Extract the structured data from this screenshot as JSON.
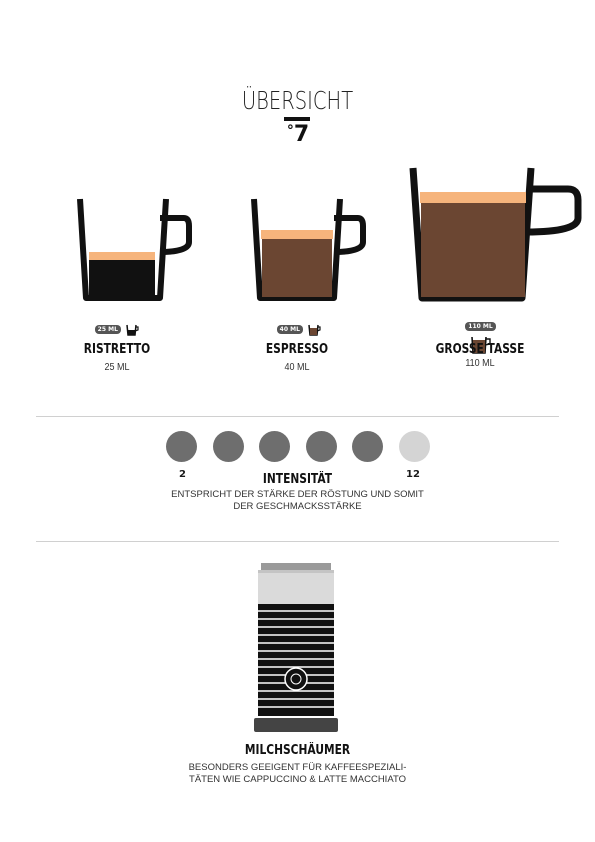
{
  "header": {
    "title": "ÜBERSICHT",
    "logo_number": "7",
    "logo_degree": "°"
  },
  "cups": [
    {
      "name": "RISTRETTO",
      "volume": "25 ML",
      "badge": "25 ML"
    },
    {
      "name": "ESPRESSO",
      "volume": "40 ML",
      "badge": "40 ML"
    },
    {
      "name": "GROSSE TASSE",
      "volume": "110 ML",
      "badge": "110 ML"
    }
  ],
  "intensity": {
    "title": "INTENSITÄT",
    "min": "2",
    "max": "12",
    "level": 5,
    "total": 6,
    "description_line1": "ENTSPRICHT DER STÄRKE DER RÖSTUNG UND SOMIT",
    "description_line2": "DER GESCHMACKSSTÄRKE",
    "active_color": "#6e6e6e",
    "inactive_color": "#d4d4d4"
  },
  "milk_frother": {
    "title": "MILCHSCHÄUMER",
    "description_line1": "BESONDERS GEEIGENT FÜR KAFFEESPEZIALI-",
    "description_line2": "TÄTEN WIE CAPPUCCINO & LATTE MACCHIATO"
  },
  "colors": {
    "crema": "#f6b47c",
    "coffee": "#6b4632",
    "dark": "#111111"
  }
}
